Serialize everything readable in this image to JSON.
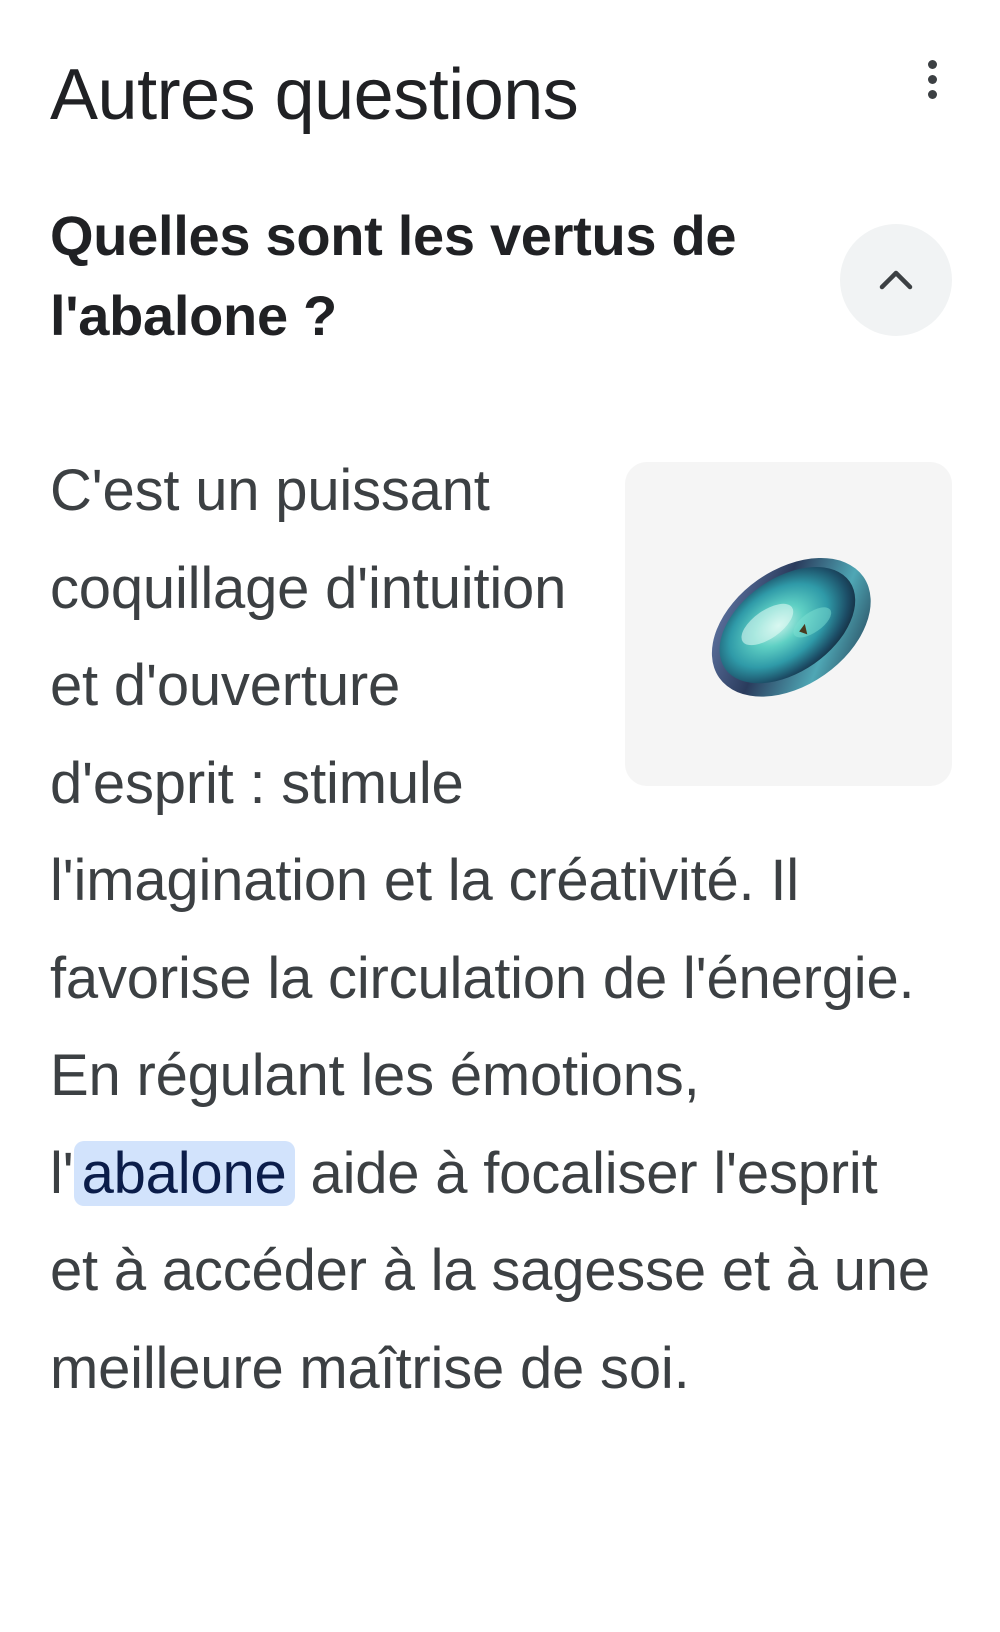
{
  "section": {
    "title": "Autres questions"
  },
  "icons": {
    "menu": "more-vert-icon",
    "collapse": "chevron-up-icon"
  },
  "question": {
    "text": "Quelles sont les vertus de l'abalone ?"
  },
  "answer": {
    "before_highlight": "C'est un puissant coquillage d'intuition et d'ouverture d'esprit : stimule l'imagination et la créativité. Il favorise la circulation de l'énergie. En régulant les émotions, l'",
    "highlight": "abalone",
    "after_highlight": " aide à focaliser l'esprit et à accéder à la sagesse et à une meilleure maîtrise de soi."
  },
  "colors": {
    "text_primary": "#202124",
    "text_secondary": "#3c4043",
    "highlight_bg": "#d2e3fc",
    "button_bg": "#f1f3f4",
    "image_bg": "#f5f5f5"
  }
}
